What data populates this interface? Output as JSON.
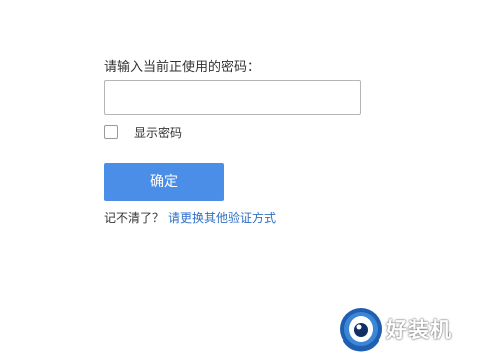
{
  "form": {
    "prompt_label": "请输入当前正使用的密码：",
    "password_value": "",
    "show_password_label": "显示密码",
    "show_password_checked": false,
    "confirm_label": "确定",
    "forgot_text": "记不清了？",
    "other_method_link": "请更换其他验证方式"
  },
  "colors": {
    "confirm_button": "#4a8ee8",
    "link": "#2e6fc6"
  },
  "watermark": {
    "text": "好装机",
    "icon": "mascot-logo-icon"
  }
}
